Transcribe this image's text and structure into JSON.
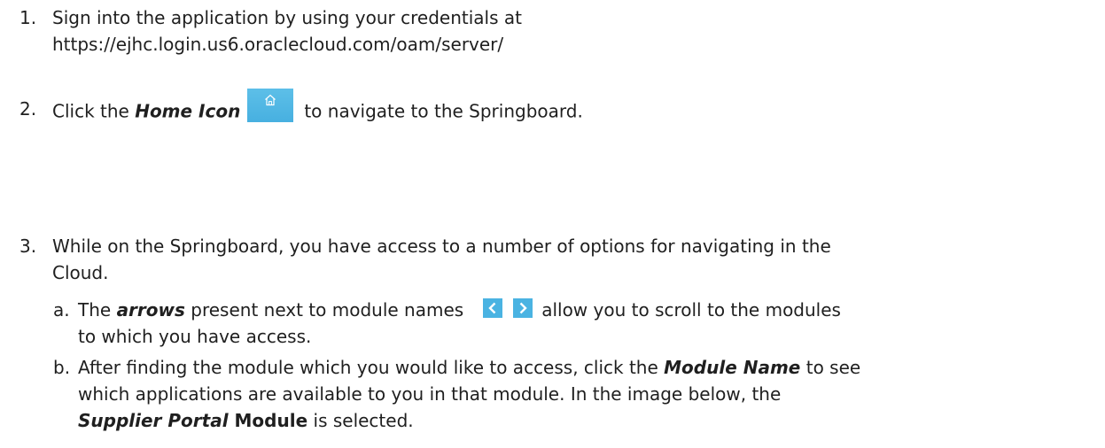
{
  "steps": [
    {
      "number": "1.",
      "line1": "Sign into the application by using  your credentials at",
      "line2": "https://ejhc.login.us6.oraclecloud.com/oam/server/"
    },
    {
      "number": "2.",
      "before": "Click the ",
      "emphasis": "Home Icon",
      "after": "to navigate to the Springboard.",
      "icon": "home-icon"
    },
    {
      "number": "3.",
      "line1": "While on the Springboard, you have access to a number of options for navigating in the",
      "line2": "Cloud.",
      "substeps": [
        {
          "letter": "a.",
          "before": "The ",
          "emphasis": "arrows",
          "middle": " present next to module names",
          "after": "allow you to scroll to the modules",
          "line2": "to which you have access.",
          "icons": [
            "chevron-left-icon",
            "chevron-right-icon"
          ]
        },
        {
          "letter": "b.",
          "line1_before": "After finding the module which you would like to access, click the ",
          "line1_emphasis": "Module Name",
          "line1_after": " to see",
          "line2": "which applications are available to you in that module. In the image below, the",
          "line3_emphasis": "Supplier Portal",
          "line3_strong": " Module",
          "line3_after": " is selected."
        }
      ]
    }
  ],
  "colors": {
    "icon_blue": "#4ab3e2",
    "text": "#1f1f1f"
  }
}
